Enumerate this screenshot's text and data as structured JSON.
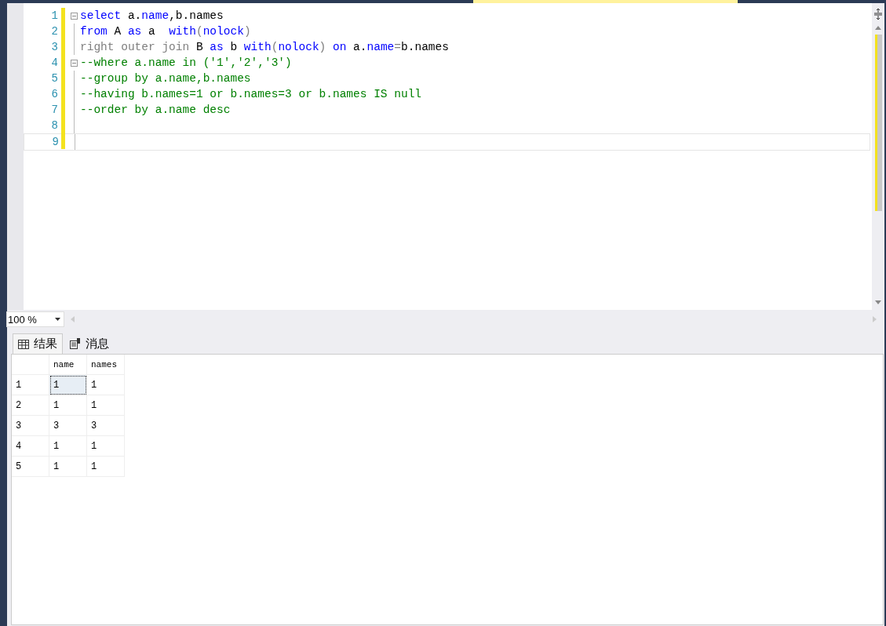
{
  "editor": {
    "lines": [
      {
        "number": "1",
        "foldable": true,
        "tokens": [
          {
            "kind": "keyword",
            "text": "select"
          },
          {
            "kind": "plain",
            "text": " a."
          },
          {
            "kind": "keyword",
            "text": "name"
          },
          {
            "kind": "plain",
            "text": ",b.names"
          }
        ]
      },
      {
        "number": "2",
        "foldable": false,
        "tokens": [
          {
            "kind": "keyword",
            "text": "from"
          },
          {
            "kind": "plain",
            "text": " A "
          },
          {
            "kind": "keyword",
            "text": "as"
          },
          {
            "kind": "plain",
            "text": " a  "
          },
          {
            "kind": "keyword",
            "text": "with"
          },
          {
            "kind": "operator",
            "text": "("
          },
          {
            "kind": "keyword",
            "text": "nolock"
          },
          {
            "kind": "operator",
            "text": ")"
          }
        ]
      },
      {
        "number": "3",
        "foldable": false,
        "tokens": [
          {
            "kind": "operator",
            "text": "right outer join"
          },
          {
            "kind": "plain",
            "text": " B "
          },
          {
            "kind": "keyword",
            "text": "as"
          },
          {
            "kind": "plain",
            "text": " b "
          },
          {
            "kind": "keyword",
            "text": "with"
          },
          {
            "kind": "operator",
            "text": "("
          },
          {
            "kind": "keyword",
            "text": "nolock"
          },
          {
            "kind": "operator",
            "text": ")"
          },
          {
            "kind": "keyword",
            "text": " on"
          },
          {
            "kind": "plain",
            "text": " a."
          },
          {
            "kind": "keyword",
            "text": "name"
          },
          {
            "kind": "operator",
            "text": "="
          },
          {
            "kind": "plain",
            "text": "b.names"
          }
        ]
      },
      {
        "number": "4",
        "foldable": true,
        "tokens": [
          {
            "kind": "comment",
            "text": "--where a.name in ('1','2','3')"
          }
        ]
      },
      {
        "number": "5",
        "foldable": false,
        "tokens": [
          {
            "kind": "comment",
            "text": "--group by a.name,b.names"
          }
        ]
      },
      {
        "number": "6",
        "foldable": false,
        "tokens": [
          {
            "kind": "comment",
            "text": "--having b.names=1 or b.names=3 or b.names IS null"
          }
        ]
      },
      {
        "number": "7",
        "foldable": false,
        "tokens": [
          {
            "kind": "comment",
            "text": "--order by a.name desc"
          }
        ]
      },
      {
        "number": "8",
        "foldable": false
      },
      {
        "number": "9",
        "foldable": false
      }
    ]
  },
  "zoom": {
    "value": "100 %"
  },
  "tabs": [
    {
      "label": "结果",
      "kind": "grid",
      "selected": true
    },
    {
      "label": "消息",
      "kind": "messages",
      "selected": false
    }
  ],
  "results": {
    "columns": [
      "name",
      "names"
    ],
    "rows": [
      {
        "number": "1",
        "cells": [
          {
            "text": "1",
            "selected": true
          },
          {
            "text": "1",
            "selected": false
          }
        ]
      },
      {
        "number": "2",
        "cells": [
          {
            "text": "1",
            "selected": false
          },
          {
            "text": "1",
            "selected": false
          }
        ]
      },
      {
        "number": "3",
        "cells": [
          {
            "text": "3",
            "selected": false
          },
          {
            "text": "3",
            "selected": false
          }
        ]
      },
      {
        "number": "4",
        "cells": [
          {
            "text": "1",
            "selected": false
          },
          {
            "text": "1",
            "selected": false
          }
        ]
      },
      {
        "number": "5",
        "cells": [
          {
            "text": "1",
            "selected": false
          },
          {
            "text": "1",
            "selected": false
          }
        ]
      }
    ]
  }
}
